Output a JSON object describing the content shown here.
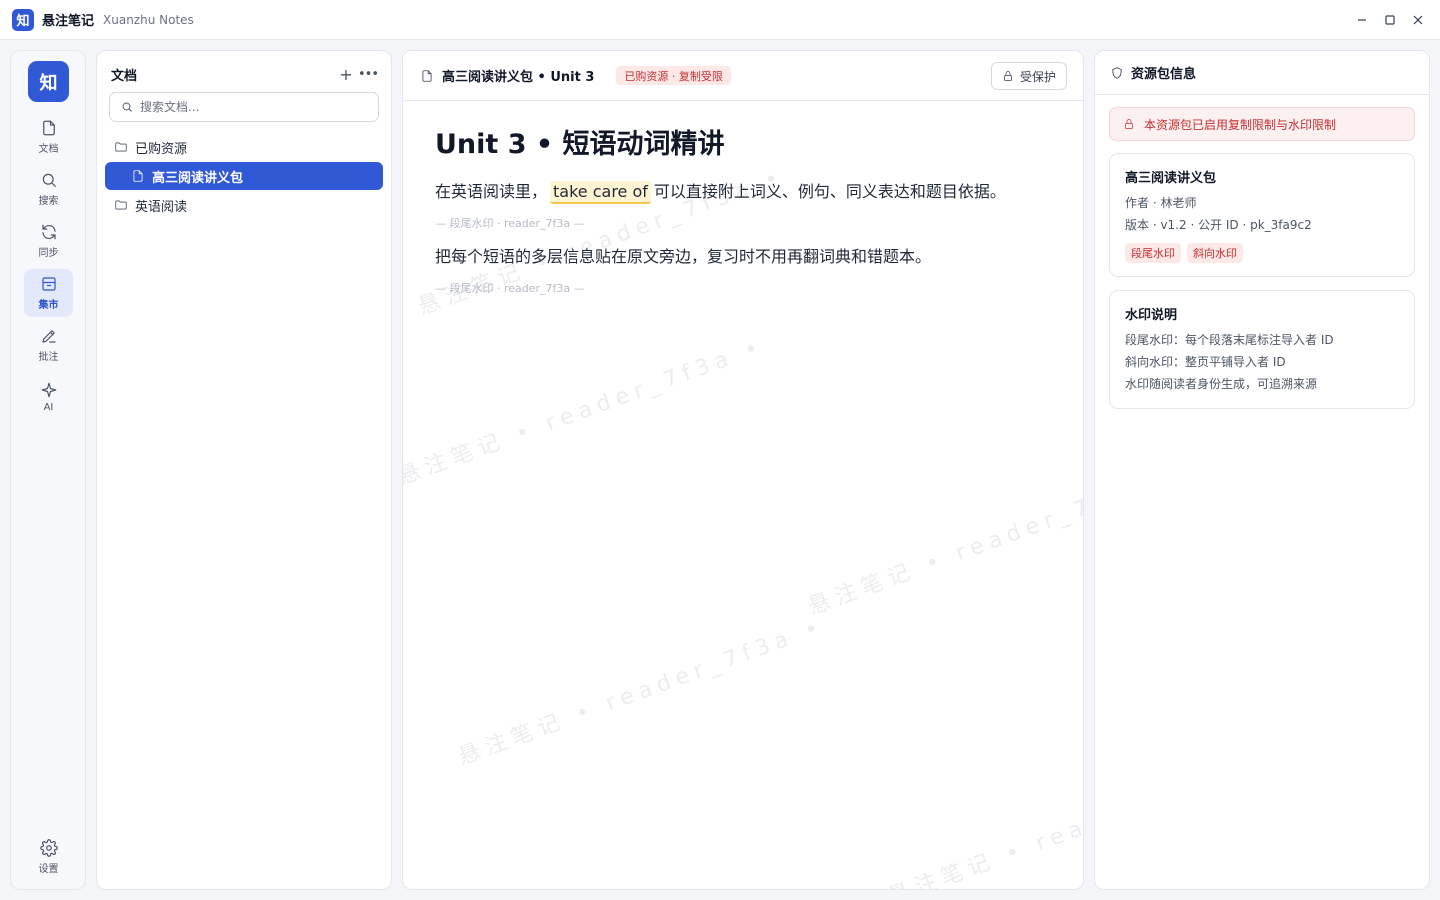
{
  "app": {
    "logo_char": "知",
    "title": "悬注笔记",
    "subtitle": "Xuanzhu Notes"
  },
  "rail": {
    "logo_char": "知",
    "items": [
      {
        "label": "文档",
        "icon": "file-icon"
      },
      {
        "label": "搜索",
        "icon": "search-icon"
      },
      {
        "label": "同步",
        "icon": "sync-icon"
      },
      {
        "label": "集市",
        "icon": "market-icon",
        "active": true
      },
      {
        "label": "批注",
        "icon": "pen-icon"
      },
      {
        "label": "AI",
        "icon": "sparkle-icon"
      }
    ],
    "settings_label": "设置"
  },
  "doclist": {
    "title": "文档",
    "search_placeholder": "搜索文档...",
    "tree": [
      {
        "label": "已购资源",
        "type": "folder"
      },
      {
        "label": "高三阅读讲义包",
        "type": "file",
        "selected": true
      },
      {
        "label": "英语阅读",
        "type": "folder"
      }
    ]
  },
  "editor": {
    "tab_title": "高三阅读讲义包 • Unit 3",
    "badge": "已购资源 · 复制受限",
    "protect_label": "受保护",
    "heading": "Unit 3 • 短语动词精讲",
    "para1": {
      "before": "在英语阅读里，",
      "highlight": "take care of",
      "after": "可以直接附上词义、例句、同义表达和题目依据。"
    },
    "watermark_line": "— 段尾水印 · reader_7f3a —",
    "para2": "把每个短语的多层信息贴在原文旁边，复习时不用再翻词典和错题本。",
    "diagonal_watermark": "悬注笔记 • reader_7f3a •"
  },
  "info": {
    "title": "资源包信息",
    "alert": "本资源包已启用复制限制与水印限制",
    "pack": {
      "title": "高三阅读讲义包",
      "author": "作者 · 林老师",
      "meta": "版本 · v1.2 · 公开 ID · pk_3fa9c2",
      "tags": [
        "段尾水印",
        "斜向水印"
      ]
    },
    "watermark_card": {
      "title": "水印说明",
      "lines": [
        "段尾水印：每个段落末尾标注导入者 ID",
        "斜向水印：整页平铺导入者 ID",
        "水印随阅读者身份生成，可追溯来源"
      ]
    }
  }
}
